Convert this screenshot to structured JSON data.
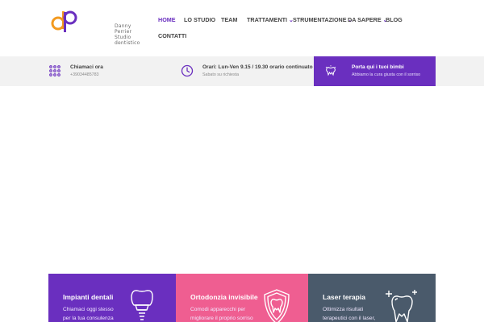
{
  "logo": {
    "name_line1": "Danny Perrier",
    "name_line2": "Studio dentistico",
    "colors": {
      "orange": "#f39a1f",
      "purple": "#6a2fbf"
    }
  },
  "nav": {
    "items": [
      {
        "label": "HOME",
        "active": true,
        "dropdown": false
      },
      {
        "label": "LO STUDIO",
        "active": false,
        "dropdown": false
      },
      {
        "label": "TEAM",
        "active": false,
        "dropdown": false
      },
      {
        "label": "TRATTAMENTI",
        "active": false,
        "dropdown": true
      },
      {
        "label": "STRUMENTAZIONE",
        "active": false,
        "dropdown": true
      },
      {
        "label": "DA SAPERE",
        "active": false,
        "dropdown": true
      },
      {
        "label": "BLOG",
        "active": false,
        "dropdown": false
      },
      {
        "label": "CONTATTI",
        "active": false,
        "dropdown": false
      }
    ]
  },
  "infobar": {
    "call": {
      "title": "Chiamaci ora",
      "subtitle": "+39034485783",
      "icon": "dial-pad-icon"
    },
    "hours": {
      "title": "Orari: Lun-Ven 9.15 / 19.30 orario continuato",
      "subtitle": "Sabato su richiesta",
      "icon": "clock-icon"
    },
    "kids": {
      "title": "Porta qui i tuoi bimbi",
      "subtitle": "Abbiamo la cura giusta con il sorriso",
      "icon": "tooth-crown-icon"
    }
  },
  "cards": [
    {
      "title": "Impianti dentali",
      "text": "Chiamaci oggi stesso per la tua consulenza",
      "icon": "dental-implant-icon",
      "color": "#6a2fbf"
    },
    {
      "title": "Ortodonzia invisibile",
      "text": "Comodi apparecchi per migliorare il proprio sorriso",
      "icon": "shield-tooth-icon",
      "color": "#ef5e91"
    },
    {
      "title": "Laser terapia",
      "text": "Ottimizza risultati terapeutici con il laser,",
      "icon": "sparkle-tooth-icon",
      "color": "#4a5a6b"
    }
  ],
  "colors": {
    "accent": "#6a2fbf",
    "infobar_bg": "#f2f2f2"
  }
}
